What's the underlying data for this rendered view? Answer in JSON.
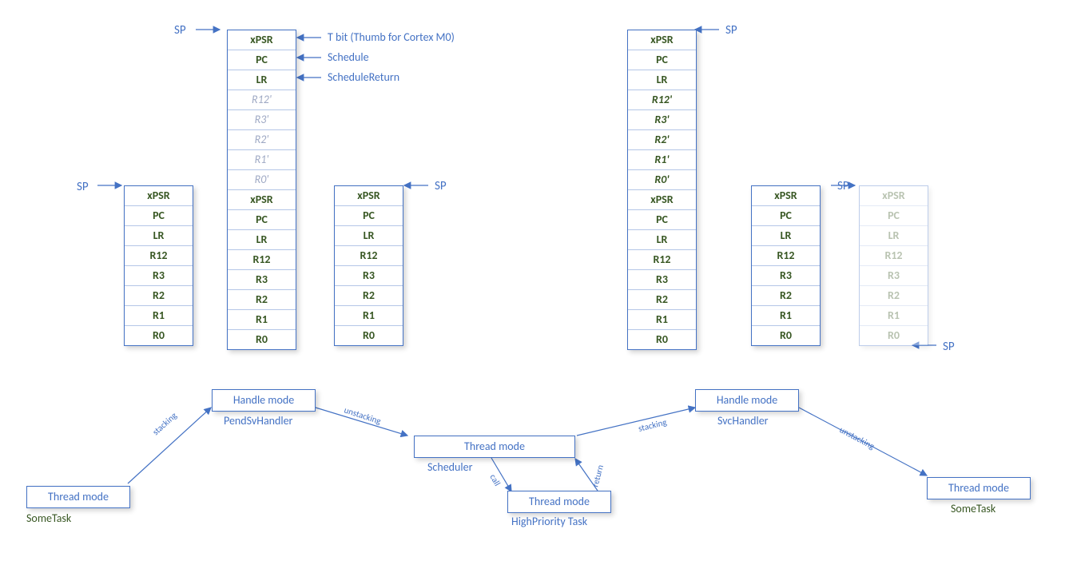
{
  "sp": "SP",
  "regs8": [
    "xPSR",
    "PC",
    "LR",
    "R12",
    "R3",
    "R2",
    "R1",
    "R0"
  ],
  "regs16_faded": [
    "R12'",
    "R3'",
    "R2'",
    "R1'",
    "R0'"
  ],
  "regs16_top": [
    "xPSR",
    "PC",
    "LR"
  ],
  "annot": {
    "tbit": "T bit (Thumb for Cortex M0)",
    "sched": "Schedule",
    "schedret": "ScheduleReturn"
  },
  "labels": {
    "thread": "Thread mode",
    "handle": "Handle mode",
    "sometask": "SomeTask",
    "pendsv": "PendSvHandler",
    "scheduler": "Scheduler",
    "hipri": "HighPriority Task",
    "svc": "SvcHandler"
  },
  "edge": {
    "stacking": "stacking",
    "unstacking": "unstacking",
    "call": "call",
    "return": "return"
  }
}
